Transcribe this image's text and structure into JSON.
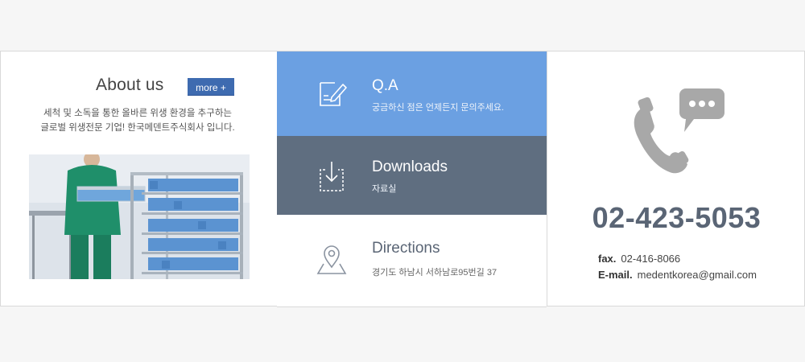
{
  "about": {
    "title": "About us",
    "more_label": "more +",
    "desc_line1": "세척 및 소독을 통한 올바른 위생 환경을 추구하는",
    "desc_line2": "글로벌 위생전문 기업! 한국메덴트주식회사 입니다."
  },
  "menu": {
    "qa": {
      "title": "Q.A",
      "subtitle": "궁금하신 점은 언제든지 문의주세요."
    },
    "downloads": {
      "title": "Downloads",
      "subtitle": "자료실"
    },
    "directions": {
      "title": "Directions",
      "subtitle": "경기도 하남시 서하남로95번길 37"
    }
  },
  "contact": {
    "phone": "02-423-5053",
    "fax_label": "fax.",
    "fax_value": "02-416-8066",
    "email_label": "E-mail.",
    "email_value": "medentkorea@gmail.com"
  },
  "colors": {
    "qa_bg": "#6ba0e2",
    "downloads_bg": "#5f6e80",
    "more_button_bg": "#3e6bb0",
    "phone_text": "#5a6575"
  },
  "icons": {
    "qa": "edit-note-icon",
    "downloads": "download-icon",
    "directions": "map-pin-icon",
    "phone": "phone-chat-icon"
  }
}
